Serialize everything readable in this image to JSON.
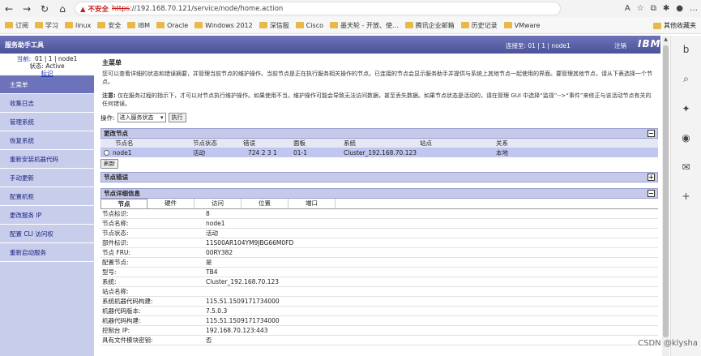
{
  "browser": {
    "warning": "不安全",
    "url_scheme": "https",
    "url_rest": "://192.168.70.121/service/node/home.action",
    "bookmarks": [
      "订阅",
      "学习",
      "linux",
      "安全",
      "IBM",
      "Oracle",
      "Windows 2012",
      "深信服",
      "Cisco",
      "墨天轮 - 开放、使...",
      "腾讯企业邮箱",
      "历史记录",
      "VMware"
    ],
    "bookmark_other": "其他收藏夹"
  },
  "app": {
    "title": "服务助手工具",
    "connection": "连接至:  01 | 1 | node1",
    "logout": "注销",
    "logo": "IBM."
  },
  "sidebar": {
    "current_label": "当前:",
    "current_value": "01 | 1 | node1",
    "status_label": "状态:",
    "status_value": "Active",
    "status_link": "标识",
    "items": [
      {
        "label": "主菜单",
        "active": true
      },
      {
        "label": "收集日志"
      },
      {
        "label": "管理系统"
      },
      {
        "label": "恢复系统"
      },
      {
        "label": "重新安装机器代码"
      },
      {
        "label": "手动更新"
      },
      {
        "label": "配置机柜"
      },
      {
        "label": "更改服务 IP"
      },
      {
        "label": "配置 CLI 访问权"
      },
      {
        "label": "重新启动服务"
      }
    ]
  },
  "main": {
    "title": "主菜单",
    "intro": "您可以查看详细的状态和错误摘要，并管理当前节点的维护操作。当前节点是正在执行服务相关操作的节点。已连接的节点会显示服务助手并提供与系统上其他节点一起使用的界面。要管理其他节点，请从下表选择一个节点。",
    "note_label": "注意:",
    "note": "仅在服务过程的指示下，才可以对节点执行维护操作。如果使用不当，维护操作可能会导致无法访问数据，甚至丢失数据。如果节点状态是活动的，请在管理 GUI 中选择“监视”-->“事件”来修正与该活动节点有关的任何错误。",
    "action_label": "操作:",
    "action_select": "进入服务状态",
    "action_button": "执行"
  },
  "change_node": {
    "title": "更改节点",
    "headers": [
      "节点名",
      "节点状态",
      "错误",
      "面板",
      "系统",
      "站点",
      "关系"
    ],
    "rows": [
      {
        "name": "node1",
        "status": "活动",
        "error": "724 2 3 1",
        "panel": "01-1",
        "system": "Cluster_192.168.70.123",
        "site": "",
        "relation": "本地"
      }
    ],
    "refresh": "刷新"
  },
  "node_error": {
    "title": "节点错误"
  },
  "node_detail": {
    "title": "节点详细信息",
    "tabs": [
      "节点",
      "硬件",
      "访问",
      "位置",
      "端口"
    ],
    "rows": [
      {
        "k": "节点标识:",
        "v": "8"
      },
      {
        "k": "节点名称:",
        "v": "node1"
      },
      {
        "k": "节点状态:",
        "v": "活动"
      },
      {
        "k": "部件标识:",
        "v": "11S00AR104YM9JBG66M0FD"
      },
      {
        "k": "节点 FRU:",
        "v": "00RY382"
      },
      {
        "k": "配置节点:",
        "v": "是"
      },
      {
        "k": "型号:",
        "v": "TB4"
      },
      {
        "k": "系统:",
        "v": "Cluster_192.168.70.123"
      },
      {
        "k": "站点名称:",
        "v": ""
      },
      {
        "k": "系统机器代码构建:",
        "v": "115.51.1509171734000"
      },
      {
        "k": "机器代码版本:",
        "v": "7.5.0.3"
      },
      {
        "k": "机器代码构建:",
        "v": "115.51.1509171734000"
      },
      {
        "k": "控制台 IP:",
        "v": "192.168.70.123:443"
      },
      {
        "k": "具有文件模块密钥:",
        "v": "否"
      }
    ]
  },
  "watermark": "CSDN @klysha"
}
